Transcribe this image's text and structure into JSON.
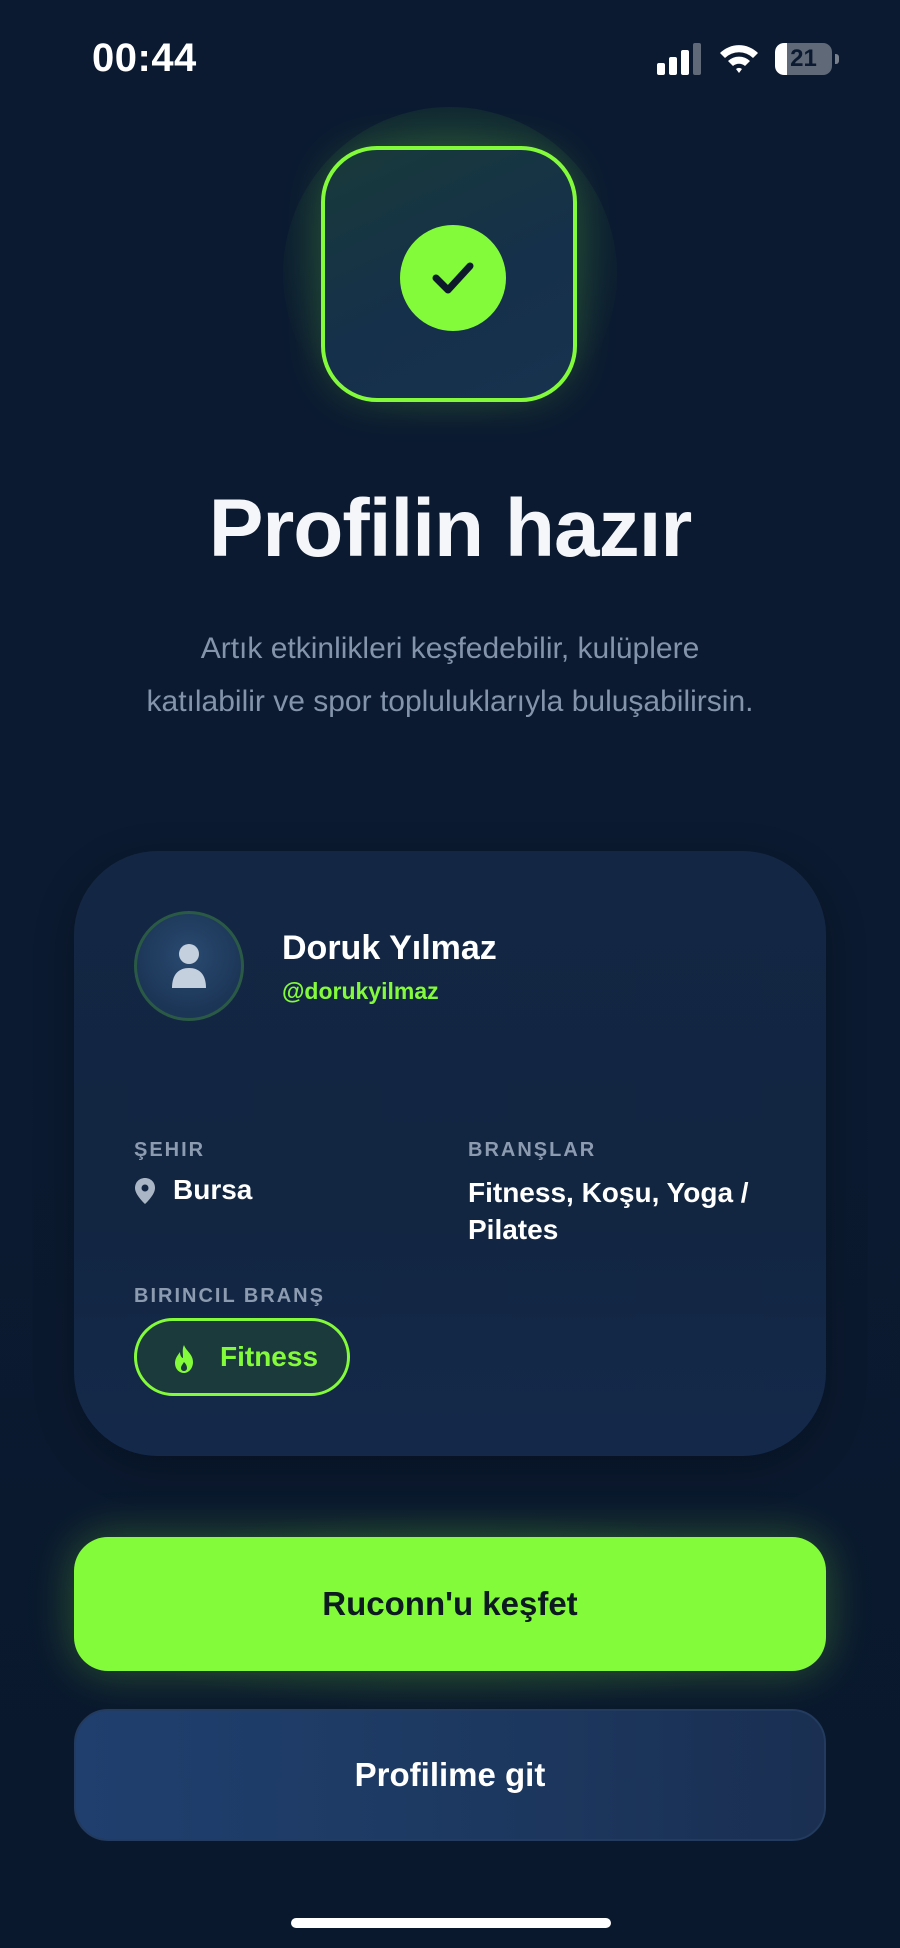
{
  "status_bar": {
    "time": "00:44",
    "battery_level": "21",
    "battery_fraction": 0.21
  },
  "success": {
    "icon": "check-icon",
    "title": "Profilin hazır",
    "subtitle": "Artık etkinlikleri keşfedebilir, kulüplere katılabilir ve spor topluluklarıyla buluşabilirsin."
  },
  "profile": {
    "name": "Doruk Yılmaz",
    "handle": "@dorukyilmaz",
    "city_label": "ŞEHIR",
    "city": "Bursa",
    "branches_label": "BRANŞLAR",
    "branches": "Fitness, Koşu, Yoga / Pilates",
    "primary_branch_label": "BIRINCIL BRANŞ",
    "primary_branch": "Fitness"
  },
  "actions": {
    "explore_label": "Ruconn'u keşfet",
    "profile_label": "Profilime git"
  },
  "colors": {
    "background": "#0b1a30",
    "accent": "#84fb3a",
    "card": "#132744",
    "muted_text": "#8394ab"
  }
}
